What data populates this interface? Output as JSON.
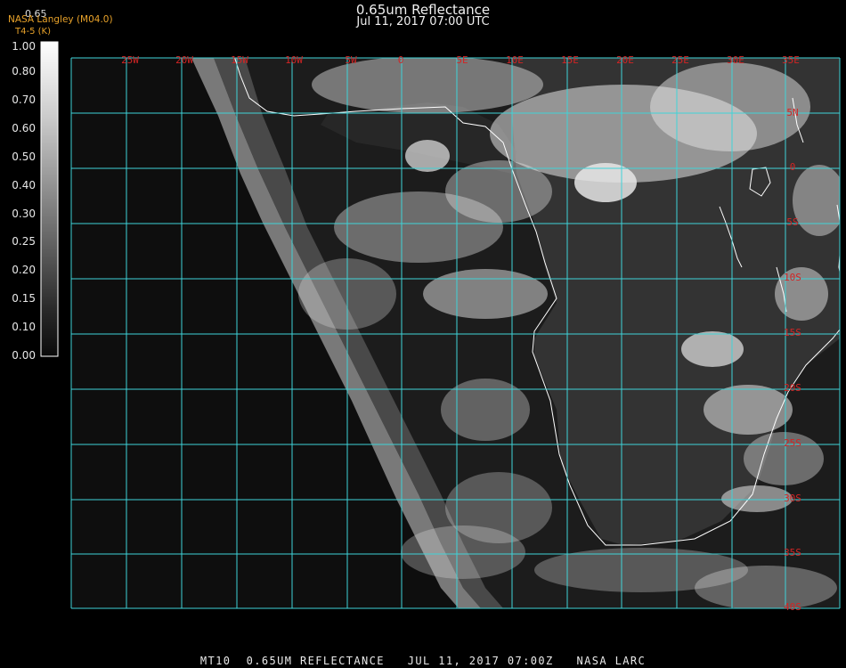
{
  "header": {
    "title": "0.65um Reflectance",
    "subtitle": "Jul 11, 2017 07:00 UTC",
    "brand": "NASA Langley (M04.0)",
    "brand_sub": "T4-5 (K)",
    "corner_value": "0.65"
  },
  "colorbar": {
    "labels": [
      "1.00",
      "0.80",
      "0.70",
      "0.60",
      "0.50",
      "0.40",
      "0.30",
      "0.25",
      "0.20",
      "0.15",
      "0.10",
      "0.00"
    ]
  },
  "map": {
    "longitude_labels": [
      "25W",
      "20W",
      "15W",
      "10W",
      "5W",
      "0",
      "5E",
      "10E",
      "15E",
      "20E",
      "25E",
      "30E",
      "35E"
    ],
    "latitude_labels": [
      "5N",
      "0",
      "5S",
      "10S",
      "15S",
      "20S",
      "25S",
      "30S",
      "35S",
      "40S"
    ],
    "grid_color": "#3fd3d8",
    "label_color": "#d42424"
  },
  "footer": {
    "text": "MT10  0.65UM REFLECTANCE   JUL 11, 2017 07:00Z   NASA LARC"
  }
}
